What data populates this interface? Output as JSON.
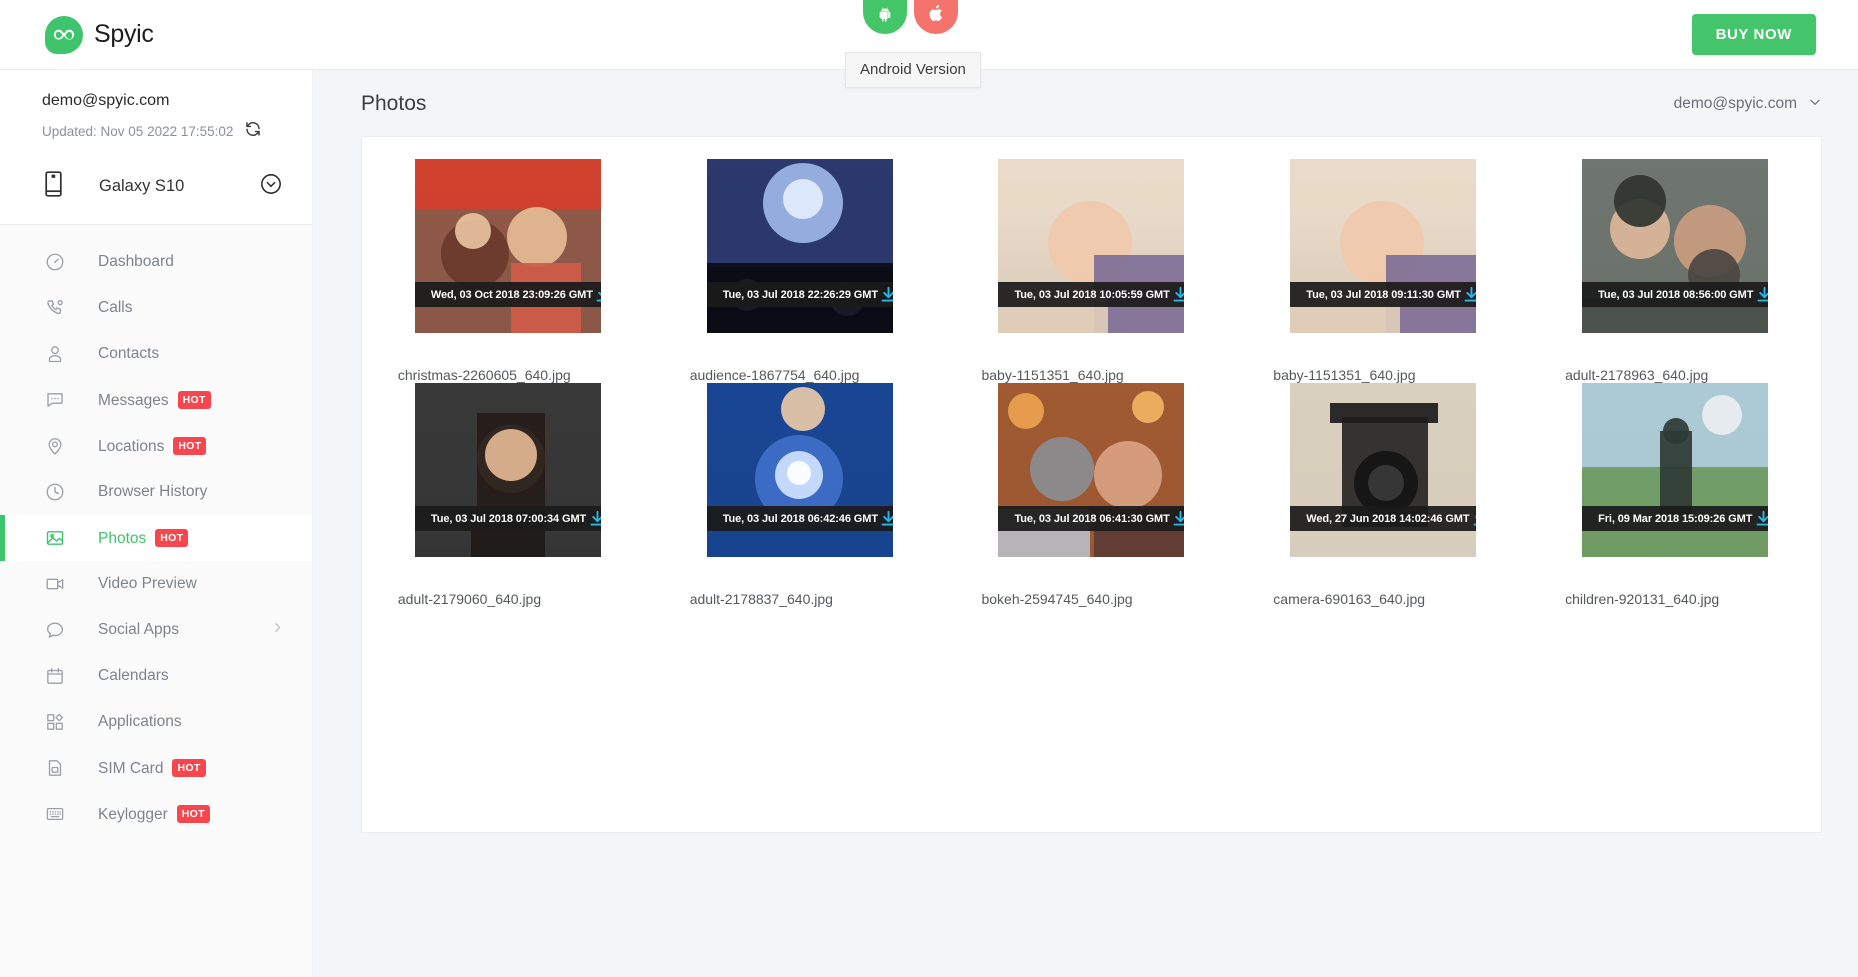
{
  "brand": {
    "name": "Spyic",
    "logo_icon": "infinity-mask-icon"
  },
  "topbar": {
    "platform_buttons": [
      {
        "id": "android",
        "icon": "android-icon",
        "color": "#44c568",
        "active": true
      },
      {
        "id": "ios",
        "icon": "apple-icon",
        "color": "#f4736a",
        "active": false
      }
    ],
    "tooltip": "Android Version",
    "buy_now_label": "BUY NOW",
    "buy_now_color": "#44c56b"
  },
  "sidebar": {
    "account_email": "demo@spyic.com",
    "updated_label": "Updated: Nov 05 2022 17:55:02",
    "refresh_icon": "refresh-icon",
    "device": {
      "name": "Galaxy S10",
      "icon": "phone-icon",
      "caret_icon": "chevron-down-circle-icon"
    },
    "items": [
      {
        "label": "Dashboard",
        "icon": "speedometer-icon",
        "badge": null,
        "active": false,
        "has_submenu": false
      },
      {
        "label": "Calls",
        "icon": "phone-call-icon",
        "badge": null,
        "active": false,
        "has_submenu": false
      },
      {
        "label": "Contacts",
        "icon": "user-icon",
        "badge": null,
        "active": false,
        "has_submenu": false
      },
      {
        "label": "Messages",
        "icon": "chat-bubble-icon",
        "badge": "HOT",
        "active": false,
        "has_submenu": false
      },
      {
        "label": "Locations",
        "icon": "map-pin-icon",
        "badge": "HOT",
        "active": false,
        "has_submenu": false
      },
      {
        "label": "Browser History",
        "icon": "clock-icon",
        "badge": null,
        "active": false,
        "has_submenu": false
      },
      {
        "label": "Photos",
        "icon": "image-icon",
        "badge": "HOT",
        "active": true,
        "has_submenu": false
      },
      {
        "label": "Video Preview",
        "icon": "video-camera-icon",
        "badge": null,
        "active": false,
        "has_submenu": false
      },
      {
        "label": "Social Apps",
        "icon": "speech-bubble-icon",
        "badge": null,
        "active": false,
        "has_submenu": true
      },
      {
        "label": "Calendars",
        "icon": "calendar-icon",
        "badge": null,
        "active": false,
        "has_submenu": false
      },
      {
        "label": "Applications",
        "icon": "apps-grid-icon",
        "badge": null,
        "active": false,
        "has_submenu": false
      },
      {
        "label": "SIM Card",
        "icon": "sim-card-icon",
        "badge": "HOT",
        "active": false,
        "has_submenu": false
      },
      {
        "label": "Keylogger",
        "icon": "keyboard-icon",
        "badge": "HOT",
        "active": false,
        "has_submenu": false
      }
    ],
    "badge_color": "#f8464f",
    "active_color": "#3dc46c"
  },
  "main": {
    "title": "Photos",
    "user_menu_label": "demo@spyic.com",
    "user_menu_icon": "chevron-down-icon",
    "download_icon": "download-icon",
    "photos": [
      {
        "filename": "christmas-2260605_640.jpg",
        "timestamp": "Wed, 03 Oct 2018 23:09:26 GMT"
      },
      {
        "filename": "audience-1867754_640.jpg",
        "timestamp": "Tue, 03 Jul 2018 22:26:29 GMT"
      },
      {
        "filename": "baby-1151351_640.jpg",
        "timestamp": "Tue, 03 Jul 2018 10:05:59 GMT"
      },
      {
        "filename": "baby-1151351_640.jpg",
        "timestamp": "Tue, 03 Jul 2018 09:11:30 GMT"
      },
      {
        "filename": "adult-2178963_640.jpg",
        "timestamp": "Tue, 03 Jul 2018 08:56:00 GMT"
      },
      {
        "filename": "adult-2179060_640.jpg",
        "timestamp": "Tue, 03 Jul 2018 07:00:34 GMT"
      },
      {
        "filename": "adult-2178837_640.jpg",
        "timestamp": "Tue, 03 Jul 2018 06:42:46 GMT"
      },
      {
        "filename": "bokeh-2594745_640.jpg",
        "timestamp": "Tue, 03 Jul 2018 06:41:30 GMT"
      },
      {
        "filename": "camera-690163_640.jpg",
        "timestamp": "Wed, 27 Jun 2018 14:02:46 GMT"
      },
      {
        "filename": "children-920131_640.jpg",
        "timestamp": "Fri, 09 Mar 2018 15:09:26 GMT"
      }
    ]
  }
}
